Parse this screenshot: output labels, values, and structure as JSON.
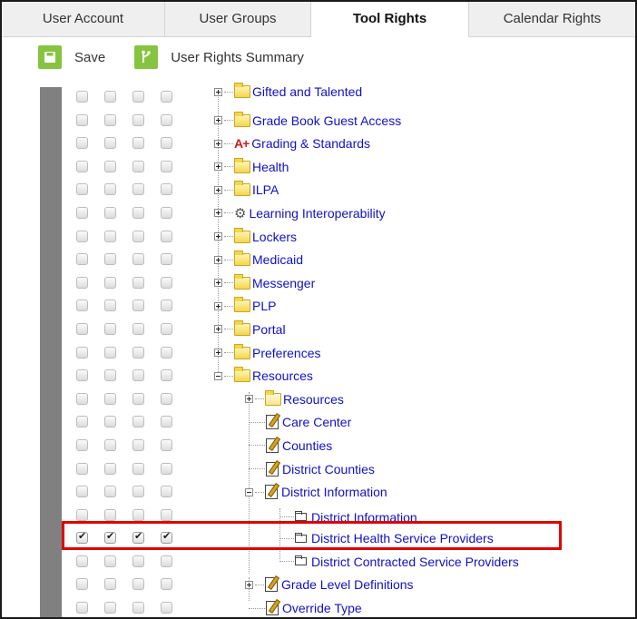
{
  "tabs": [
    {
      "label": "User Account"
    },
    {
      "label": "User Groups"
    },
    {
      "label": "Tool Rights"
    },
    {
      "label": "Calendar Rights"
    }
  ],
  "toolbar": {
    "save_label": "Save",
    "summary_label": "User Rights Summary"
  },
  "tree": [
    {
      "label": "Gifted and Talented",
      "checked": false
    },
    {
      "label": "Grade Book Guest Access",
      "checked": false
    },
    {
      "label": "Grading & Standards",
      "checked": false
    },
    {
      "label": "Health",
      "checked": false
    },
    {
      "label": "ILPA",
      "checked": false
    },
    {
      "label": "Learning Interoperability",
      "checked": false
    },
    {
      "label": "Lockers",
      "checked": false
    },
    {
      "label": "Medicaid",
      "checked": false
    },
    {
      "label": "Messenger",
      "checked": false
    },
    {
      "label": "PLP",
      "checked": false
    },
    {
      "label": "Portal",
      "checked": false
    },
    {
      "label": "Preferences",
      "checked": false
    },
    {
      "label": "Resources",
      "checked": false
    },
    {
      "label": "Resources",
      "checked": false
    },
    {
      "label": "Care Center",
      "checked": false
    },
    {
      "label": "Counties",
      "checked": false
    },
    {
      "label": "District Counties",
      "checked": false
    },
    {
      "label": "District Information",
      "checked": false
    },
    {
      "label": "District Information",
      "checked": false
    },
    {
      "label": "District Health Service Providers",
      "checked": true
    },
    {
      "label": "District Contracted Service Providers",
      "checked": false
    },
    {
      "label": "Grade Level Definitions",
      "checked": false
    },
    {
      "label": "Override Type",
      "checked": false
    }
  ],
  "colors": {
    "accent": "#86c440",
    "link": "#1010c8",
    "highlight": "#e00000"
  }
}
